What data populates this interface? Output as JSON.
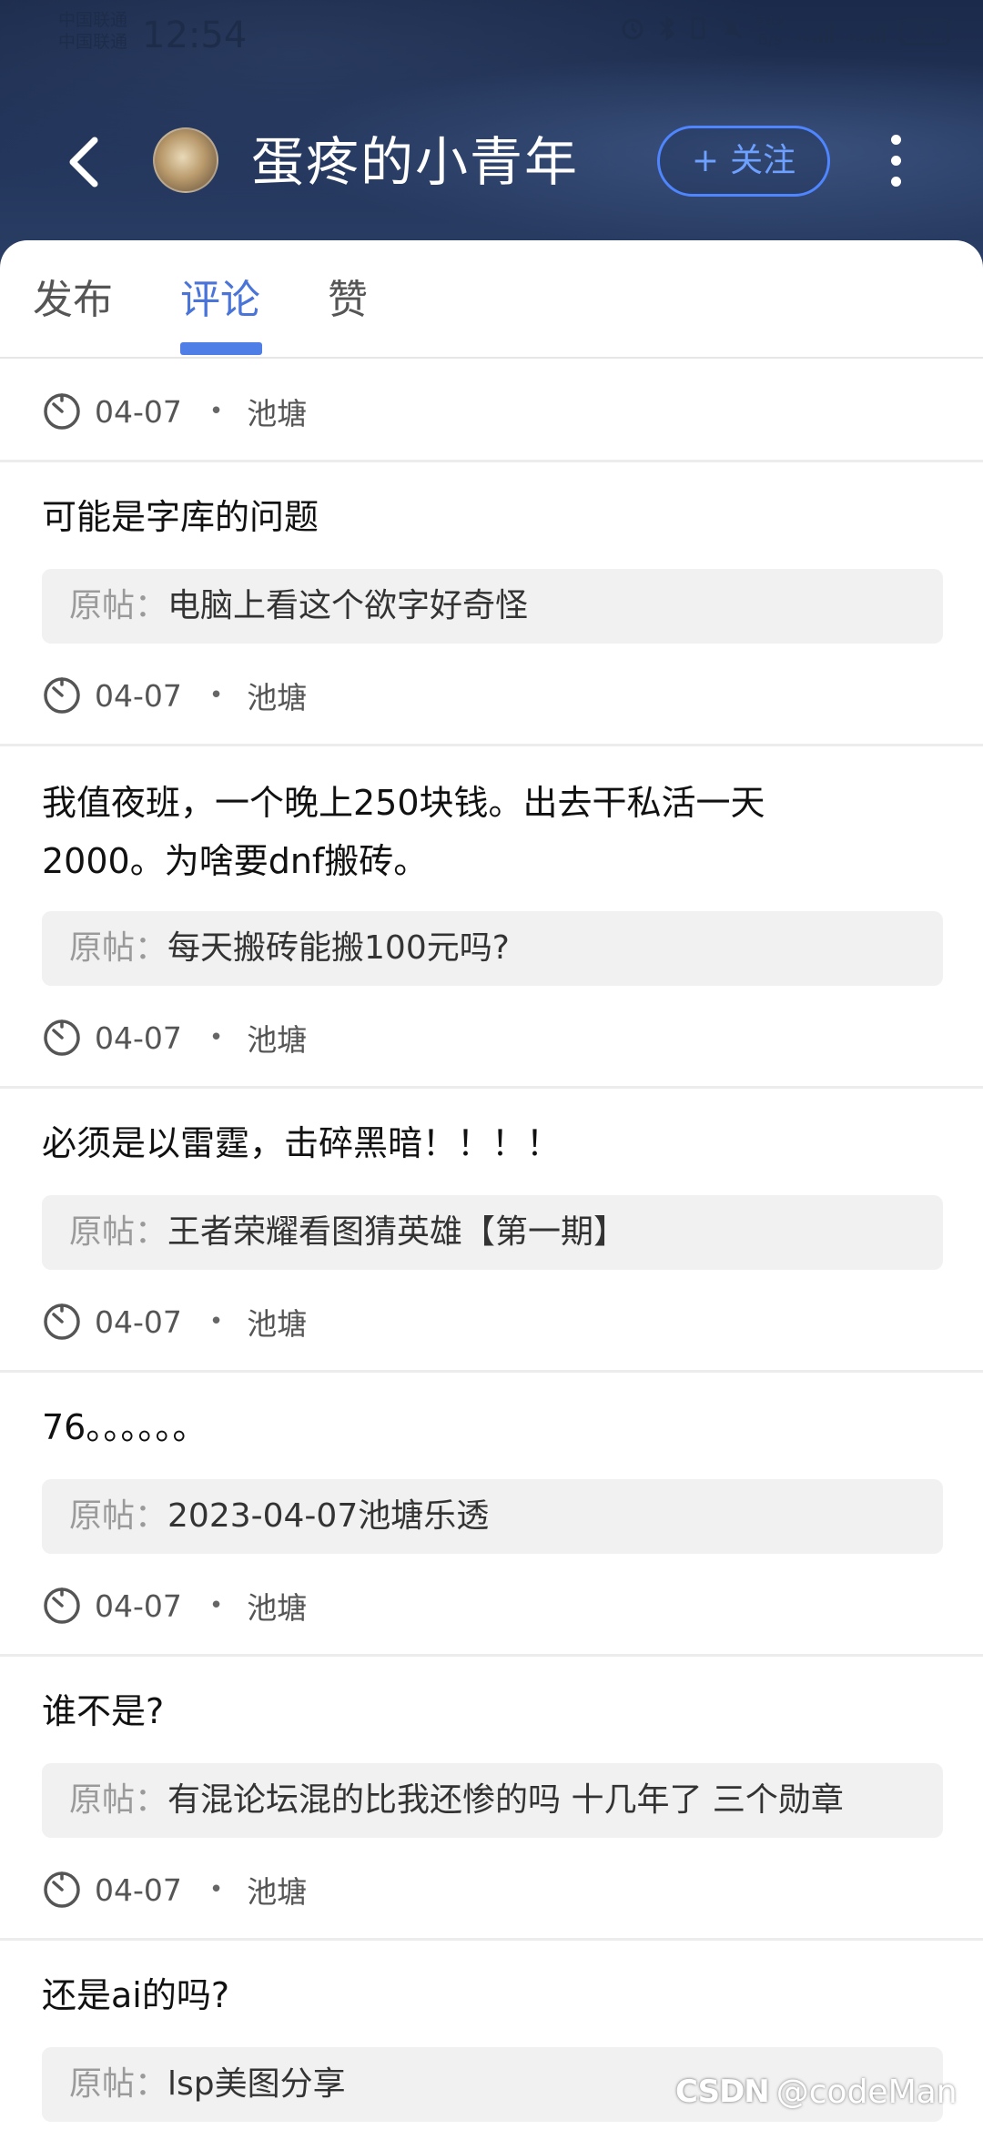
{
  "status_bar": {
    "carrier_1": "中国联通",
    "carrier_2": "中国联通",
    "time": "12:54",
    "net_speed_value": "544",
    "net_speed_unit": "B/s",
    "signal_label_1": "4G",
    "signal_label_2": "4G",
    "battery": "43"
  },
  "header": {
    "profile_name": "蛋疼的小青年",
    "follow_label": "关注",
    "follow_plus": "+"
  },
  "tabs": [
    {
      "label": "发布",
      "active": false
    },
    {
      "label": "评论",
      "active": true
    },
    {
      "label": "赞",
      "active": false
    }
  ],
  "quote_prefix": "原帖：",
  "top_meta": {
    "date": "04-07",
    "board": "池塘"
  },
  "comments": [
    {
      "text": "可能是字库的问题",
      "original_post": "电脑上看这个欲字好奇怪",
      "date": "04-07",
      "board": "池塘"
    },
    {
      "text": "我值夜班，一个晚上250块钱。出去干私活一天2000。为啥要dnf搬砖。",
      "original_post": "每天搬砖能搬100元吗?",
      "date": "04-07",
      "board": "池塘"
    },
    {
      "text": "必须是以雷霆，击碎黑暗！！！！",
      "original_post": "王者荣耀看图猜英雄【第一期】",
      "date": "04-07",
      "board": "池塘"
    },
    {
      "text": "76。。。。。。",
      "original_post": "2023-04-07池塘乐透",
      "date": "04-07",
      "board": "池塘"
    },
    {
      "text": "谁不是?",
      "original_post": "有混论坛混的比我还惨的吗 十几年了 三个勋章",
      "date": "04-07",
      "board": "池塘"
    },
    {
      "text": "还是ai的吗?",
      "original_post": "lsp美图分享"
    }
  ],
  "watermark": {
    "logo": "CSDN",
    "handle": "@codeMan"
  },
  "colors": {
    "accent": "#4f7fe6",
    "header_bg": "#1b2a4a",
    "quote_bg": "#f1f1f1"
  }
}
